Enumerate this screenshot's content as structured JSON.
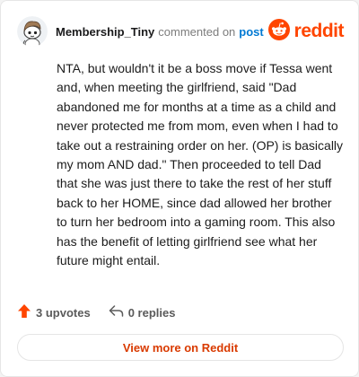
{
  "header": {
    "username": "Membership_Tiny",
    "action_text": "commented on",
    "post_link": "post",
    "brand_name": "reddit",
    "avatar_icon": "snoo-avatar-icon",
    "brand_icon": "reddit-logo-icon"
  },
  "comment": {
    "text": "NTA, but wouldn't it be a boss move if Tessa went and, when meeting the girlfriend, said \"Dad abandoned me for months at a time as a child and never protected me from mom, even when I had to take out a restraining order on her. (OP) is basically my mom AND dad.\" Then proceeded to tell Dad that she was just there to take the rest of her stuff back to her HOME, since dad allowed her brother to turn her bedroom into a gaming room. This also has the benefit of letting girlfriend see what her future might entail."
  },
  "footer": {
    "upvotes": "3 upvotes",
    "replies": "0 replies",
    "upvote_icon": "upvote-arrow-icon",
    "reply_icon": "reply-arrow-icon"
  },
  "actions": {
    "view_more": "View more on Reddit"
  },
  "colors": {
    "accent": "#ff4500",
    "link": "#0079d3",
    "button_text": "#d93a00"
  }
}
